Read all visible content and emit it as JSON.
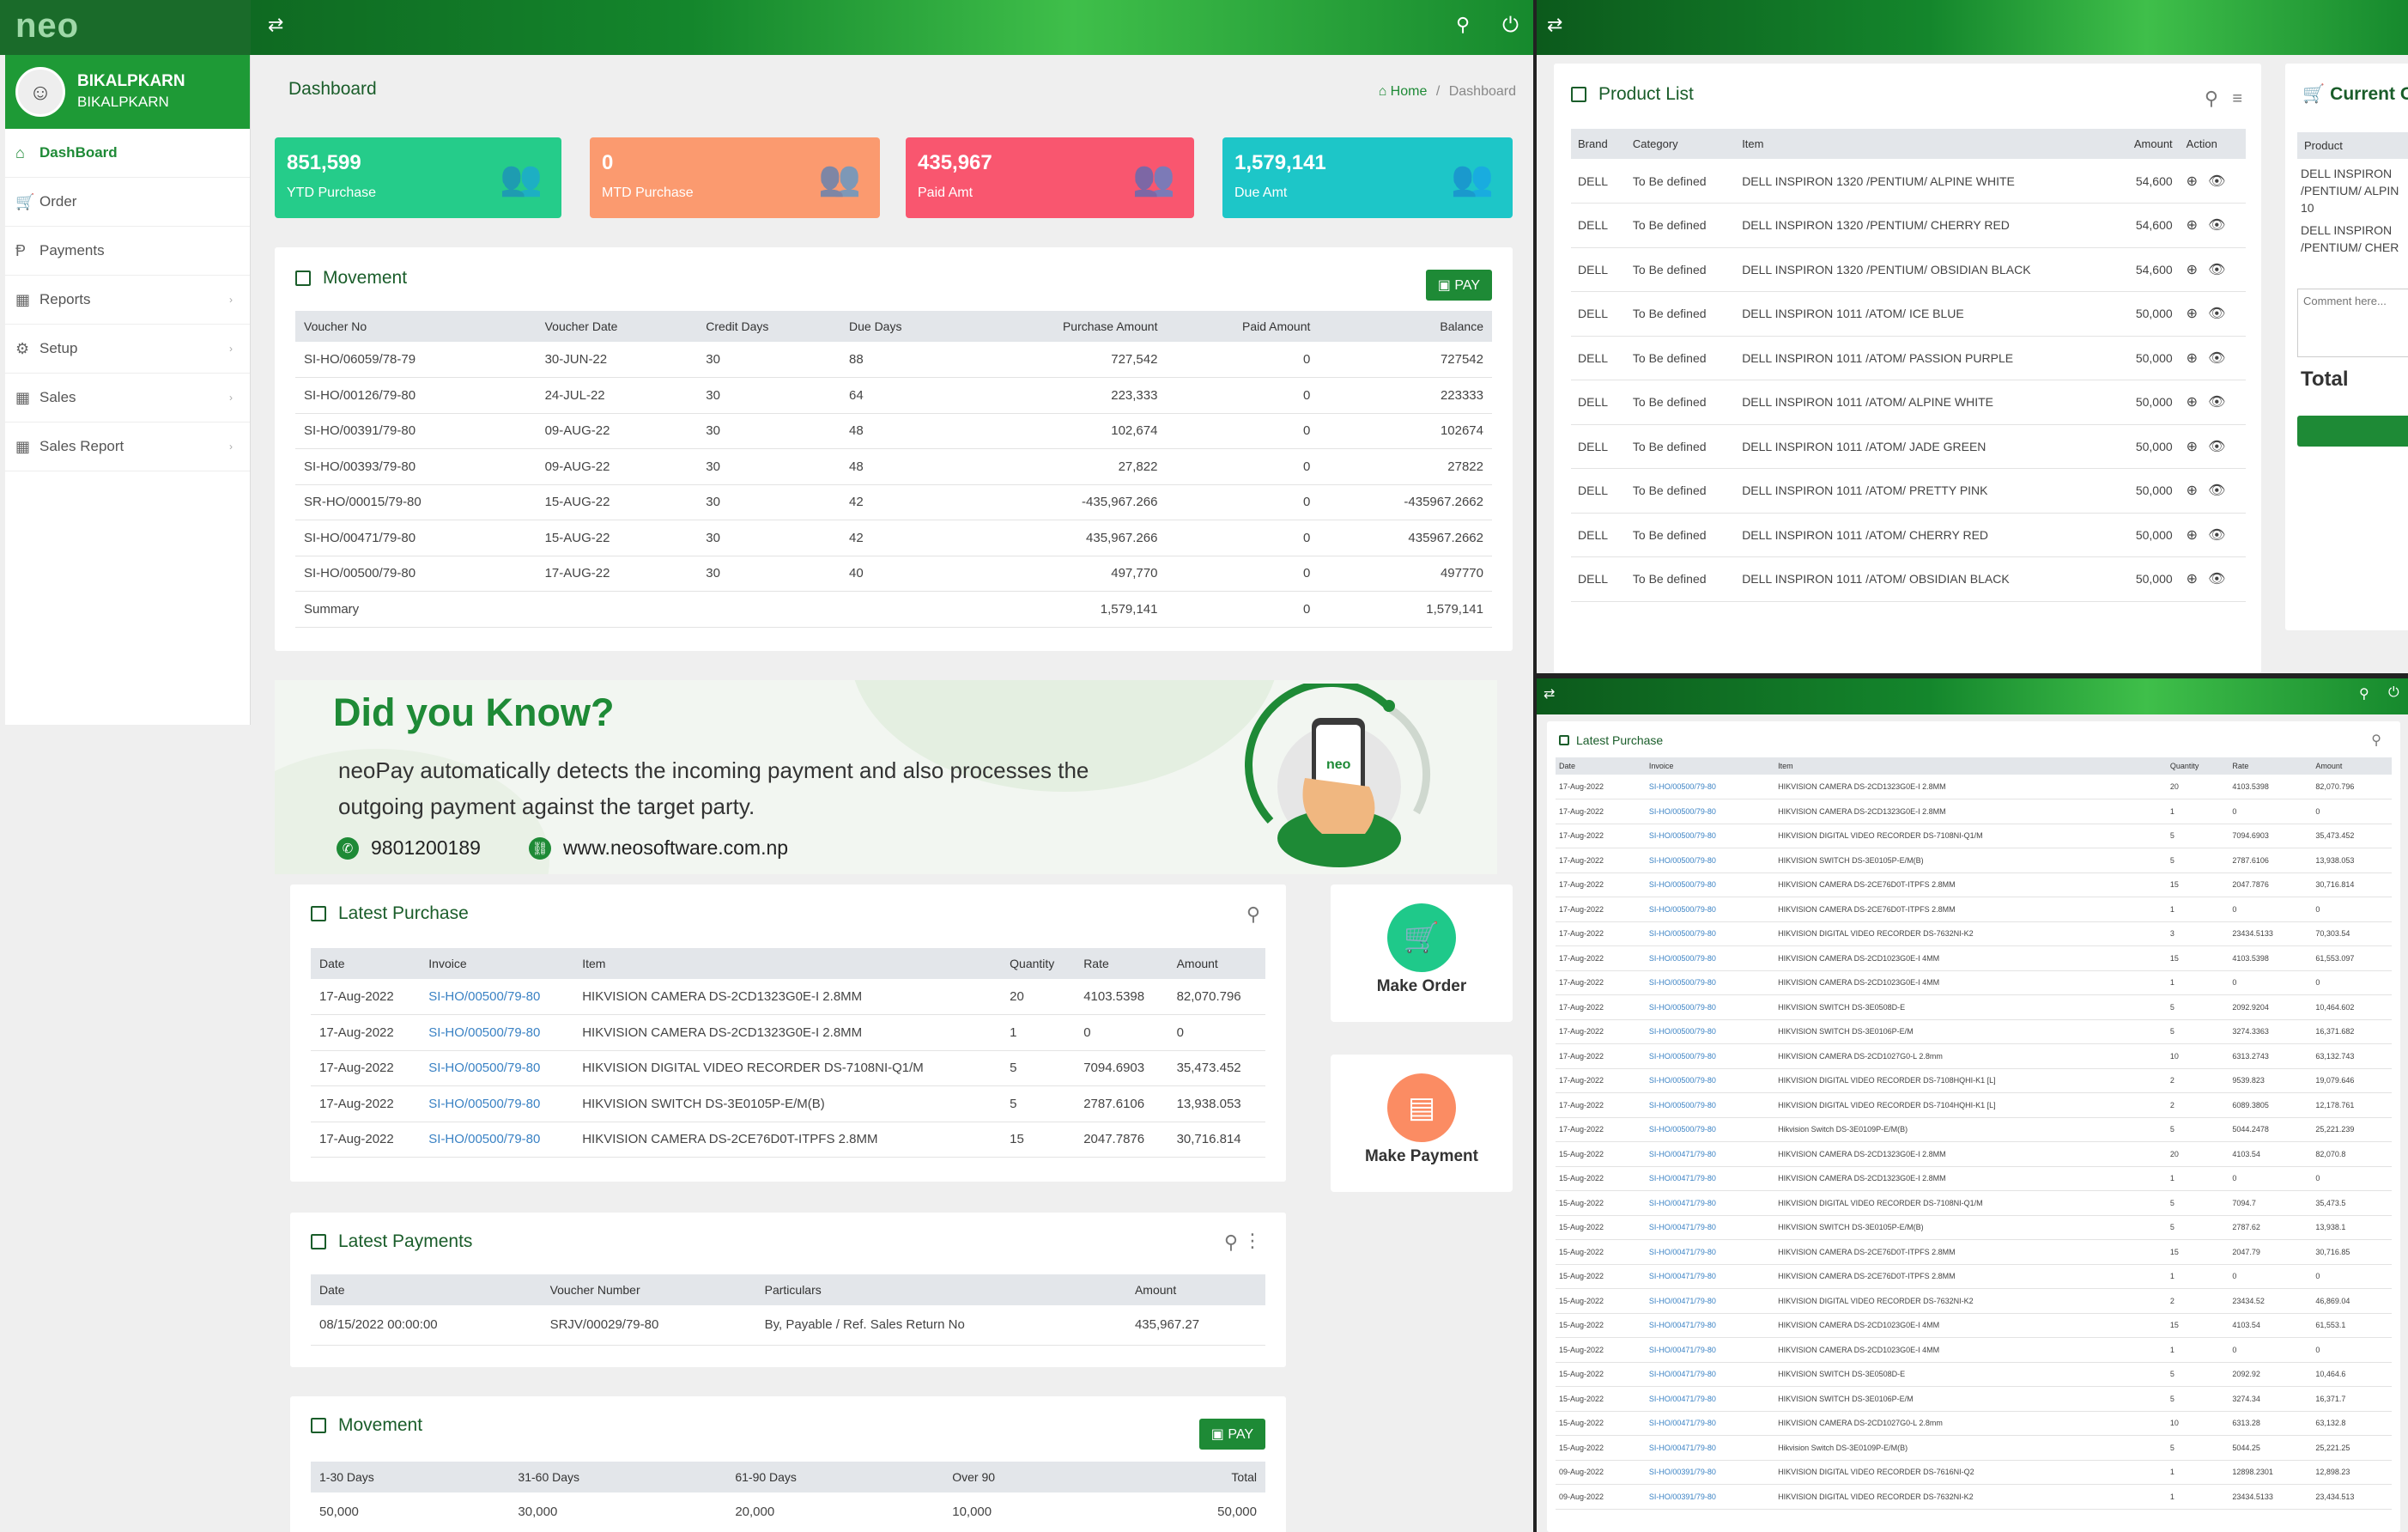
{
  "app": {
    "logo": "neo"
  },
  "user": {
    "name1": "BIKALPKARN",
    "name2": "BIKALPKARN"
  },
  "sidebar": {
    "items": [
      {
        "label": "DashBoard",
        "icon": "home-icon",
        "active": true,
        "arrow": false
      },
      {
        "label": "Order",
        "icon": "cart-icon",
        "active": false,
        "arrow": false
      },
      {
        "label": "Payments",
        "icon": "paypal-icon",
        "active": false,
        "arrow": false
      },
      {
        "label": "Reports",
        "icon": "grid-icon",
        "active": false,
        "arrow": true
      },
      {
        "label": "Setup",
        "icon": "gear-icon",
        "active": false,
        "arrow": true
      },
      {
        "label": "Sales",
        "icon": "grid-icon",
        "active": false,
        "arrow": true
      },
      {
        "label": "Sales Report",
        "icon": "grid-icon",
        "active": false,
        "arrow": true
      }
    ]
  },
  "page": {
    "title": "Dashboard",
    "crumb_home": "Home",
    "crumb_sep": "/",
    "crumb_current": "Dashboard"
  },
  "cards": [
    {
      "value": "851,599",
      "label": "YTD Purchase",
      "color": "#25cc8a"
    },
    {
      "value": "0",
      "label": "MTD Purchase",
      "color": "#fb9a6f"
    },
    {
      "value": "435,967",
      "label": "Paid Amt",
      "color": "#f9566f"
    },
    {
      "value": "1,579,141",
      "label": "Due Amt",
      "color": "#1dc6c8"
    }
  ],
  "movement": {
    "title": "Movement",
    "pay": "PAY",
    "headers": [
      "Voucher No",
      "Voucher Date",
      "Credit Days",
      "Due Days",
      "Purchase Amount",
      "Paid Amount",
      "Balance"
    ],
    "rows": [
      [
        "SI-HO/06059/78-79",
        "30-JUN-22",
        "30",
        "88",
        "727,542",
        "0",
        "727542"
      ],
      [
        "SI-HO/00126/79-80",
        "24-JUL-22",
        "30",
        "64",
        "223,333",
        "0",
        "223333"
      ],
      [
        "SI-HO/00391/79-80",
        "09-AUG-22",
        "30",
        "48",
        "102,674",
        "0",
        "102674"
      ],
      [
        "SI-HO/00393/79-80",
        "09-AUG-22",
        "30",
        "48",
        "27,822",
        "0",
        "27822"
      ],
      [
        "SR-HO/00015/79-80",
        "15-AUG-22",
        "30",
        "42",
        "-435,967.266",
        "0",
        "-435967.2662"
      ],
      [
        "SI-HO/00471/79-80",
        "15-AUG-22",
        "30",
        "42",
        "435,967.266",
        "0",
        "435967.2662"
      ],
      [
        "SI-HO/00500/79-80",
        "17-AUG-22",
        "30",
        "40",
        "497,770",
        "0",
        "497770"
      ]
    ],
    "summary": [
      "Summary",
      "",
      "",
      "",
      "1,579,141",
      "0",
      "1,579,141"
    ]
  },
  "banner": {
    "title": "Did you Know?",
    "text": "neoPay automatically detects the incoming payment and also processes the outgoing payment against the target party.",
    "phone": "9801200189",
    "website": "www.neosoftware.com.np"
  },
  "latest_purchase": {
    "title": "Latest Purchase",
    "headers": [
      "Date",
      "Invoice",
      "Item",
      "Quantity",
      "Rate",
      "Amount"
    ],
    "rows": [
      [
        "17-Aug-2022",
        "SI-HO/00500/79-80",
        "HIKVISION CAMERA DS-2CD1323G0E-I 2.8MM",
        "20",
        "4103.5398",
        "82,070.796"
      ],
      [
        "17-Aug-2022",
        "SI-HO/00500/79-80",
        "HIKVISION CAMERA DS-2CD1323G0E-I 2.8MM",
        "1",
        "0",
        "0"
      ],
      [
        "17-Aug-2022",
        "SI-HO/00500/79-80",
        "HIKVISION DIGITAL VIDEO RECORDER DS-7108NI-Q1/M",
        "5",
        "7094.6903",
        "35,473.452"
      ],
      [
        "17-Aug-2022",
        "SI-HO/00500/79-80",
        "HIKVISION SWITCH DS-3E0105P-E/M(B)",
        "5",
        "2787.6106",
        "13,938.053"
      ],
      [
        "17-Aug-2022",
        "SI-HO/00500/79-80",
        "HIKVISION CAMERA DS-2CE76D0T-ITPFS 2.8MM",
        "15",
        "2047.7876",
        "30,716.814"
      ]
    ]
  },
  "actions": {
    "make_order": "Make Order",
    "make_payment": "Make Payment"
  },
  "latest_payments": {
    "title": "Latest Payments",
    "headers": [
      "Date",
      "Voucher Number",
      "Particulars",
      "Amount"
    ],
    "rows": [
      [
        "08/15/2022 00:00:00",
        "SRJV/00029/79-80",
        "By, Payable / Ref. Sales Return No",
        "435,967.27"
      ]
    ]
  },
  "movement2": {
    "title": "Movement",
    "pay": "PAY",
    "headers": [
      "1-30 Days",
      "31-60 Days",
      "61-90 Days",
      "Over 90",
      "Total"
    ],
    "rows": [
      [
        "50,000",
        "30,000",
        "20,000",
        "10,000",
        "50,000"
      ]
    ]
  },
  "product_list": {
    "title": "Product List",
    "headers": [
      "Brand",
      "Category",
      "Item",
      "Amount",
      "Action"
    ],
    "rows": [
      [
        "DELL",
        "To Be defined",
        "DELL INSPIRON 1320 /PENTIUM/ ALPINE WHITE",
        "54,600"
      ],
      [
        "DELL",
        "To Be defined",
        "DELL INSPIRON 1320 /PENTIUM/ CHERRY RED",
        "54,600"
      ],
      [
        "DELL",
        "To Be defined",
        "DELL INSPIRON 1320 /PENTIUM/ OBSIDIAN BLACK",
        "54,600"
      ],
      [
        "DELL",
        "To Be defined",
        "DELL INSPIRON 1011 /ATOM/ ICE BLUE",
        "50,000"
      ],
      [
        "DELL",
        "To Be defined",
        "DELL INSPIRON 1011 /ATOM/ PASSION PURPLE",
        "50,000"
      ],
      [
        "DELL",
        "To Be defined",
        "DELL INSPIRON 1011 /ATOM/ ALPINE WHITE",
        "50,000"
      ],
      [
        "DELL",
        "To Be defined",
        "DELL INSPIRON 1011 /ATOM/ JADE GREEN",
        "50,000"
      ],
      [
        "DELL",
        "To Be defined",
        "DELL INSPIRON 1011 /ATOM/ PRETTY PINK",
        "50,000"
      ],
      [
        "DELL",
        "To Be defined",
        "DELL INSPIRON 1011 /ATOM/ CHERRY RED",
        "50,000"
      ],
      [
        "DELL",
        "To Be defined",
        "DELL INSPIRON 1011 /ATOM/ OBSIDIAN BLACK",
        "50,000"
      ]
    ]
  },
  "current_order": {
    "title": "Current O",
    "header": "Product",
    "items": [
      "DELL INSPIRON /PENTIUM/ ALPIN",
      "10",
      "DELL INSPIRON /PENTIUM/ CHER"
    ],
    "comment_placeholder": "Comment here...",
    "total_label": "Total"
  },
  "latest_purchase_full": {
    "title": "Latest Purchase",
    "headers": [
      "Date",
      "Invoice",
      "Item",
      "Quantity",
      "Rate",
      "Amount"
    ],
    "rows": [
      [
        "17-Aug-2022",
        "SI-HO/00500/79-80",
        "HIKVISION CAMERA DS-2CD1323G0E-I 2.8MM",
        "20",
        "4103.5398",
        "82,070.796"
      ],
      [
        "17-Aug-2022",
        "SI-HO/00500/79-80",
        "HIKVISION CAMERA DS-2CD1323G0E-I 2.8MM",
        "1",
        "0",
        "0"
      ],
      [
        "17-Aug-2022",
        "SI-HO/00500/79-80",
        "HIKVISION DIGITAL VIDEO RECORDER DS-7108NI-Q1/M",
        "5",
        "7094.6903",
        "35,473.452"
      ],
      [
        "17-Aug-2022",
        "SI-HO/00500/79-80",
        "HIKVISION SWITCH DS-3E0105P-E/M(B)",
        "5",
        "2787.6106",
        "13,938.053"
      ],
      [
        "17-Aug-2022",
        "SI-HO/00500/79-80",
        "HIKVISION CAMERA DS-2CE76D0T-ITPFS 2.8MM",
        "15",
        "2047.7876",
        "30,716.814"
      ],
      [
        "17-Aug-2022",
        "SI-HO/00500/79-80",
        "HIKVISION CAMERA DS-2CE76D0T-ITPFS 2.8MM",
        "1",
        "0",
        "0"
      ],
      [
        "17-Aug-2022",
        "SI-HO/00500/79-80",
        "HIKVISION DIGITAL VIDEO RECORDER DS-7632NI-K2",
        "3",
        "23434.5133",
        "70,303.54"
      ],
      [
        "17-Aug-2022",
        "SI-HO/00500/79-80",
        "HIKVISION CAMERA DS-2CD1023G0E-I 4MM",
        "15",
        "4103.5398",
        "61,553.097"
      ],
      [
        "17-Aug-2022",
        "SI-HO/00500/79-80",
        "HIKVISION CAMERA DS-2CD1023G0E-I 4MM",
        "1",
        "0",
        "0"
      ],
      [
        "17-Aug-2022",
        "SI-HO/00500/79-80",
        "HIKVISION SWITCH DS-3E0508D-E",
        "5",
        "2092.9204",
        "10,464.602"
      ],
      [
        "17-Aug-2022",
        "SI-HO/00500/79-80",
        "HIKVISION SWITCH DS-3E0106P-E/M",
        "5",
        "3274.3363",
        "16,371.682"
      ],
      [
        "17-Aug-2022",
        "SI-HO/00500/79-80",
        "HIKVISION CAMERA DS-2CD1027G0-L 2.8mm",
        "10",
        "6313.2743",
        "63,132.743"
      ],
      [
        "17-Aug-2022",
        "SI-HO/00500/79-80",
        "HIKVISION DIGITAL VIDEO RECORDER DS-7108HQHI-K1 [L]",
        "2",
        "9539.823",
        "19,079.646"
      ],
      [
        "17-Aug-2022",
        "SI-HO/00500/79-80",
        "HIKVISION DIGITAL VIDEO RECORDER DS-7104HQHI-K1 [L]",
        "2",
        "6089.3805",
        "12,178.761"
      ],
      [
        "17-Aug-2022",
        "SI-HO/00500/79-80",
        "Hikvision Switch DS-3E0109P-E/M(B)",
        "5",
        "5044.2478",
        "25,221.239"
      ],
      [
        "15-Aug-2022",
        "SI-HO/00471/79-80",
        "HIKVISION CAMERA DS-2CD1323G0E-I 2.8MM",
        "20",
        "4103.54",
        "82,070.8"
      ],
      [
        "15-Aug-2022",
        "SI-HO/00471/79-80",
        "HIKVISION CAMERA DS-2CD1323G0E-I 2.8MM",
        "1",
        "0",
        "0"
      ],
      [
        "15-Aug-2022",
        "SI-HO/00471/79-80",
        "HIKVISION DIGITAL VIDEO RECORDER DS-7108NI-Q1/M",
        "5",
        "7094.7",
        "35,473.5"
      ],
      [
        "15-Aug-2022",
        "SI-HO/00471/79-80",
        "HIKVISION SWITCH DS-3E0105P-E/M(B)",
        "5",
        "2787.62",
        "13,938.1"
      ],
      [
        "15-Aug-2022",
        "SI-HO/00471/79-80",
        "HIKVISION CAMERA DS-2CE76D0T-ITPFS 2.8MM",
        "15",
        "2047.79",
        "30,716.85"
      ],
      [
        "15-Aug-2022",
        "SI-HO/00471/79-80",
        "HIKVISION CAMERA DS-2CE76D0T-ITPFS 2.8MM",
        "1",
        "0",
        "0"
      ],
      [
        "15-Aug-2022",
        "SI-HO/00471/79-80",
        "HIKVISION DIGITAL VIDEO RECORDER DS-7632NI-K2",
        "2",
        "23434.52",
        "46,869.04"
      ],
      [
        "15-Aug-2022",
        "SI-HO/00471/79-80",
        "HIKVISION CAMERA DS-2CD1023G0E-I 4MM",
        "15",
        "4103.54",
        "61,553.1"
      ],
      [
        "15-Aug-2022",
        "SI-HO/00471/79-80",
        "HIKVISION CAMERA DS-2CD1023G0E-I 4MM",
        "1",
        "0",
        "0"
      ],
      [
        "15-Aug-2022",
        "SI-HO/00471/79-80",
        "HIKVISION SWITCH DS-3E0508D-E",
        "5",
        "2092.92",
        "10,464.6"
      ],
      [
        "15-Aug-2022",
        "SI-HO/00471/79-80",
        "HIKVISION SWITCH DS-3E0106P-E/M",
        "5",
        "3274.34",
        "16,371.7"
      ],
      [
        "15-Aug-2022",
        "SI-HO/00471/79-80",
        "HIKVISION CAMERA DS-2CD1027G0-L 2.8mm",
        "10",
        "6313.28",
        "63,132.8"
      ],
      [
        "15-Aug-2022",
        "SI-HO/00471/79-80",
        "Hikvision Switch DS-3E0109P-E/M(B)",
        "5",
        "5044.25",
        "25,221.25"
      ],
      [
        "09-Aug-2022",
        "SI-HO/00391/79-80",
        "HIKVISION DIGITAL VIDEO RECORDER DS-7616NI-Q2",
        "1",
        "12898.2301",
        "12,898.23"
      ],
      [
        "09-Aug-2022",
        "SI-HO/00391/79-80",
        "HIKVISION DIGITAL VIDEO RECORDER DS-7632NI-K2",
        "1",
        "23434.5133",
        "23,434.513"
      ]
    ]
  }
}
